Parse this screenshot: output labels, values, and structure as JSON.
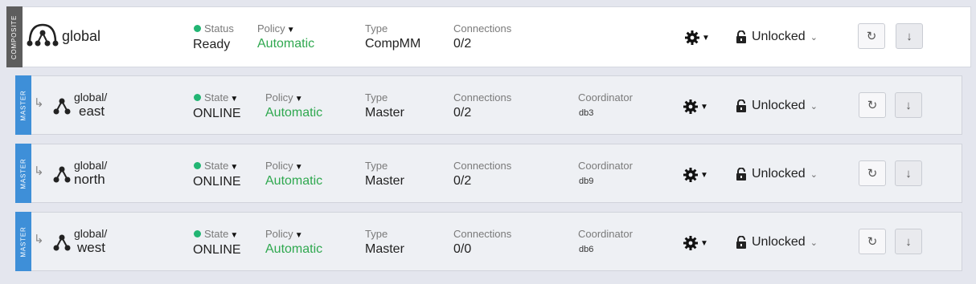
{
  "composite": {
    "side_label": "COMPOSITE",
    "name": "global",
    "status_label": "Status",
    "status_value": "Ready",
    "policy_label": "Policy",
    "policy_value": "Automatic",
    "type_label": "Type",
    "type_value": "CompMM",
    "connections_label": "Connections",
    "connections_value": "0/2",
    "lock_label": "Unlocked"
  },
  "services": [
    {
      "side_label": "MASTER",
      "name_prefix": "global/",
      "name": "east",
      "state_label": "State",
      "state_value": "ONLINE",
      "policy_label": "Policy",
      "policy_value": "Automatic",
      "type_label": "Type",
      "type_value": "Master",
      "connections_label": "Connections",
      "connections_value": "0/2",
      "coordinator_label": "Coordinator",
      "coordinator_value": "db3",
      "lock_label": "Unlocked"
    },
    {
      "side_label": "MASTER",
      "name_prefix": "global/",
      "name": "north",
      "state_label": "State",
      "state_value": "ONLINE",
      "policy_label": "Policy",
      "policy_value": "Automatic",
      "type_label": "Type",
      "type_value": "Master",
      "connections_label": "Connections",
      "connections_value": "0/2",
      "coordinator_label": "Coordinator",
      "coordinator_value": "db9",
      "lock_label": "Unlocked"
    },
    {
      "side_label": "MASTER",
      "name_prefix": "global/",
      "name": "west",
      "state_label": "State",
      "state_value": "ONLINE",
      "policy_label": "Policy",
      "policy_value": "Automatic",
      "type_label": "Type",
      "type_value": "Master",
      "connections_label": "Connections",
      "connections_value": "0/0",
      "coordinator_label": "Coordinator",
      "coordinator_value": "db6",
      "lock_label": "Unlocked"
    }
  ],
  "icons": {
    "status_dot": "green-dot",
    "settings": "gear-icon",
    "lock": "lock-icon",
    "refresh": "refresh-icon",
    "download": "arrow-down-icon",
    "cluster": "cluster-nodes-icon"
  },
  "colors": {
    "ok_green": "#22b573",
    "policy_green": "#2fa84f",
    "composite_band": "#5d5d5d",
    "master_band": "#3e8fd8"
  }
}
